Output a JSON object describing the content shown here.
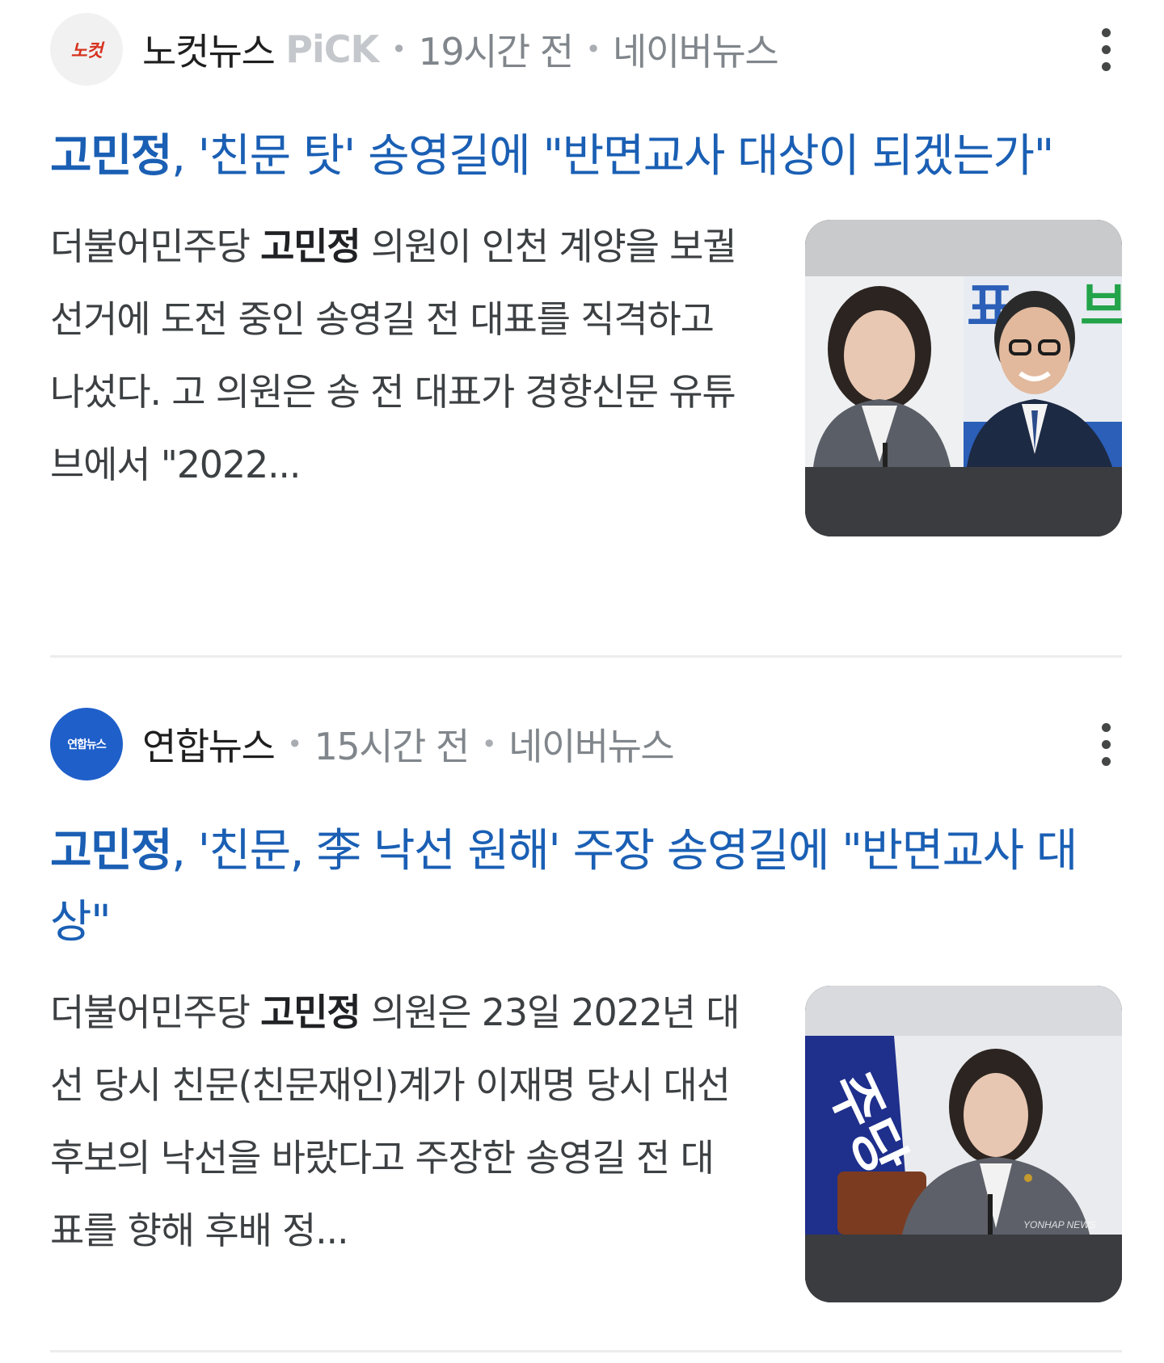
{
  "articles": [
    {
      "source": {
        "logo_text": "노컷",
        "name": "노컷뉴스",
        "badge": "PiCK",
        "time": "19시간 전",
        "platform": "네이버뉴스",
        "logo_bg": "#f1f1f1",
        "logo_fg": "#d7321f"
      },
      "headline": {
        "keyword": "고민정",
        "rest": ", '친문 탓' 송영길에 \"반면교사 대상이 되겠는가\""
      },
      "snippet": {
        "pre": "더불어민주당 ",
        "keyword": "고민정",
        "post": " 의원이 인천 계양을 보궐선거에 도전 중인 송영길 전 대표를 직격하고 나섰다. 고 의원은 송 전 대표가 경향신문 유튜브에서 \"2022..."
      },
      "thumbnail": "photo of two politicians: a woman speaking at a microphone and a smiling man with glasses"
    },
    {
      "source": {
        "logo_text": "연합뉴스",
        "name": "연합뉴스",
        "badge": "",
        "time": "15시간 전",
        "platform": "네이버뉴스",
        "logo_bg": "#1f5fc9",
        "logo_fg": "#ffffff"
      },
      "headline": {
        "keyword": "고민정",
        "rest": ", '친문, 李 낙선 원해' 주장 송영길에 \"반면교사 대상\""
      },
      "snippet": {
        "pre": "더불어민주당 ",
        "keyword": "고민정",
        "post": " 의원은 23일 2022년 대선 당시 친문(친문재인)계가 이재명 당시 대선 후보의 낙선을 바랐다고 주장한 송영길 전 대표를 향해 후배 정..."
      },
      "thumbnail": "photo of a woman in a grey jacket speaking at a microphone in front of a blue party banner",
      "watermark": "YONHAP NEWS"
    }
  ],
  "colors": {
    "headline": "#1a5fb4",
    "meta": "#80868b",
    "snippet": "#3c4043"
  }
}
